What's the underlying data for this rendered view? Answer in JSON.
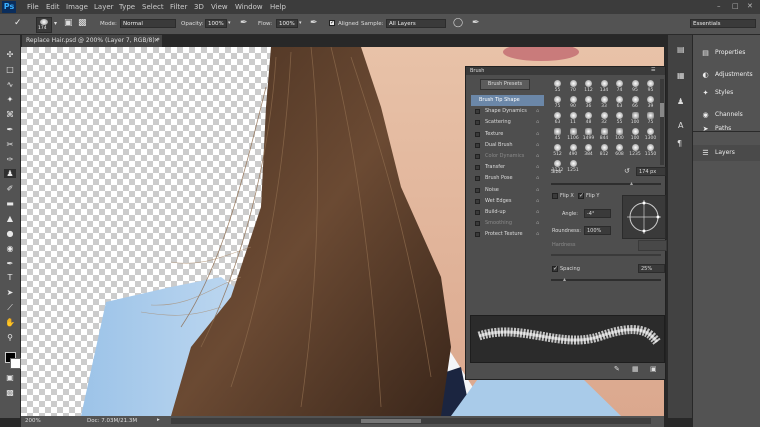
{
  "app": {
    "logo": "Ps"
  },
  "menu": [
    "File",
    "Edit",
    "Image",
    "Layer",
    "Type",
    "Select",
    "Filter",
    "3D",
    "View",
    "Window",
    "Help"
  ],
  "options": {
    "brush_size": "174",
    "mode_label": "Mode:",
    "mode_value": "Normal",
    "opacity_label": "Opacity:",
    "opacity_value": "100%",
    "flow_label": "Flow:",
    "flow_value": "100%",
    "aligned_label": "Aligned",
    "sample_label": "Sample:",
    "sample_value": "All Layers",
    "workspace": "Essentials"
  },
  "document": {
    "tab_title": "Replace Hair.psd @ 200% (Layer 7, RGB/8) *",
    "zoom": "200%",
    "doc_info": "Doc: 7.03M/21.3M"
  },
  "right_panel": {
    "items": [
      "Properties",
      "Adjustments",
      "Styles",
      "Channels",
      "Paths",
      "Layers"
    ]
  },
  "brush_panel": {
    "tab": "Brush",
    "presets_button": "Brush Presets",
    "options": [
      {
        "label": "Brush Tip Shape",
        "checked": false,
        "selected": true,
        "lock": false
      },
      {
        "label": "Shape Dynamics",
        "checked": false,
        "selected": false,
        "lock": true
      },
      {
        "label": "Scattering",
        "checked": false,
        "selected": false,
        "lock": true
      },
      {
        "label": "Texture",
        "checked": false,
        "selected": false,
        "lock": true
      },
      {
        "label": "Dual Brush",
        "checked": false,
        "selected": false,
        "lock": true
      },
      {
        "label": "Color Dynamics",
        "checked": false,
        "selected": false,
        "lock": true,
        "dim": true
      },
      {
        "label": "Transfer",
        "checked": false,
        "selected": false,
        "lock": true
      },
      {
        "label": "Brush Pose",
        "checked": false,
        "selected": false,
        "lock": true
      },
      {
        "label": "Noise",
        "checked": false,
        "selected": false,
        "lock": true
      },
      {
        "label": "Wet Edges",
        "checked": false,
        "selected": false,
        "lock": true
      },
      {
        "label": "Build-up",
        "checked": false,
        "selected": false,
        "lock": true
      },
      {
        "label": "Smoothing",
        "checked": false,
        "selected": false,
        "lock": true,
        "dim": true
      },
      {
        "label": "Protect Texture",
        "checked": false,
        "selected": false,
        "lock": true
      }
    ],
    "tips": [
      "55",
      "70",
      "112",
      "134",
      "74",
      "95",
      "95",
      "75",
      "90",
      "36",
      "33",
      "63",
      "66",
      "39",
      "63",
      "11",
      "48",
      "32",
      "55",
      "100",
      "75",
      "45",
      "1106",
      "1499",
      "844",
      "100",
      "100",
      "1300",
      "512",
      "490",
      "384",
      "812",
      "608",
      "1235",
      "1150",
      "1132",
      "1251"
    ],
    "size_label": "Size",
    "size_value": "174 px",
    "flipx_label": "Flip X",
    "flipy_label": "Flip Y",
    "angle_label": "Angle:",
    "angle_value": "-4°",
    "roundness_label": "Roundness:",
    "roundness_value": "100%",
    "hardness_label": "Hardness",
    "spacing_label": "Spacing",
    "spacing_value": "25%"
  }
}
